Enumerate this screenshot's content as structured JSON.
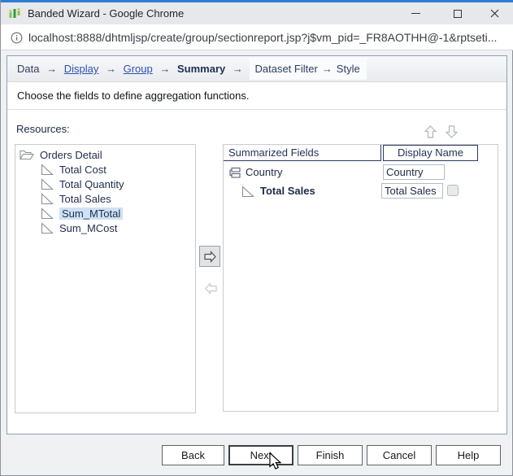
{
  "window": {
    "title": "Banded Wizard - Google Chrome"
  },
  "address_bar": {
    "url": "localhost:8888/dhtmljsp/create/group/sectionreport.jsp?j$vm_pid=_FR8AOTHH@-1&rptseti..."
  },
  "breadcrumb": {
    "separator": "→",
    "steps": [
      {
        "label": "Data",
        "type": "plain"
      },
      {
        "label": "Display",
        "type": "link"
      },
      {
        "label": "Group",
        "type": "link"
      },
      {
        "label": "Summary",
        "type": "current"
      },
      {
        "label": "Dataset Filter",
        "type": "future"
      },
      {
        "label": "Style",
        "type": "future"
      }
    ]
  },
  "instruction": "Choose the fields to define aggregation functions.",
  "resources": {
    "label": "Resources:",
    "tree": {
      "root": "Orders Detail",
      "items": [
        "Total Cost",
        "Total Quantity",
        "Total Sales",
        "Sum_MTotal",
        "Sum_MCost"
      ],
      "selected": "Sum_MTotal"
    }
  },
  "summary_table": {
    "headers": [
      "Summarized Fields",
      "Display Name"
    ],
    "rows": [
      {
        "field": "Country",
        "type": "group",
        "display_name": "Country"
      },
      {
        "field": "Total Sales",
        "type": "summary",
        "display_name": "Total Sales",
        "checkbox_checked": false
      }
    ]
  },
  "buttons": {
    "back": "Back",
    "next": "Next",
    "finish": "Finish",
    "cancel": "Cancel",
    "help": "Help"
  },
  "icons": [
    "app-logo-icon",
    "info-icon",
    "minimize-icon",
    "maximize-icon",
    "close-icon",
    "open-folder-icon",
    "field-triangle-icon",
    "group-icon",
    "move-up-icon",
    "move-down-icon",
    "move-right-icon",
    "move-left-icon",
    "mouse-cursor"
  ],
  "colors": {
    "titlebar_accent": "#2e7dd2",
    "link_blue": "#2a52b0",
    "header_navy": "#2b3a5e",
    "selection_highlight": "#cfe2f5",
    "logo_green_light": "#8bc53f",
    "logo_green_dark": "#2f9e44"
  }
}
